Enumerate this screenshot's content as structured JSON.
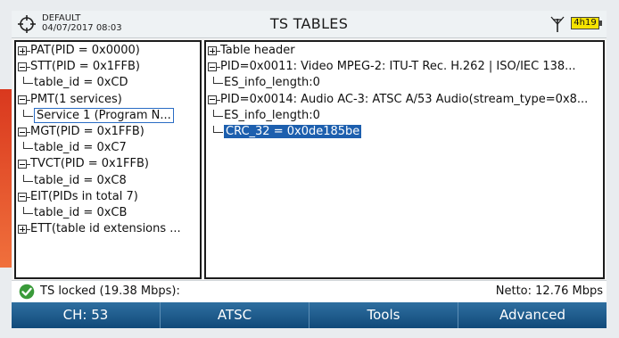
{
  "header": {
    "profile_name": "DEFAULT",
    "datetime": "04/07/2017 08:03",
    "title": "TS TABLES",
    "battery_label": "4h19"
  },
  "left_tree": [
    {
      "label": "PAT(PID = 0x0000)",
      "toggle": "plus"
    },
    {
      "label": "STT(PID = 0x1FFB)",
      "toggle": "minus"
    },
    {
      "label": "table_id = 0xCD",
      "toggle": "leaf"
    },
    {
      "label": "PMT(1 services)",
      "toggle": "minus"
    },
    {
      "label": "Service 1 (Program N...",
      "toggle": "leaf",
      "selected": true
    },
    {
      "label": "MGT(PID = 0x1FFB)",
      "toggle": "minus"
    },
    {
      "label": "table_id = 0xC7",
      "toggle": "leaf"
    },
    {
      "label": "TVCT(PID = 0x1FFB)",
      "toggle": "minus"
    },
    {
      "label": "table_id = 0xC8",
      "toggle": "leaf"
    },
    {
      "label": "EIT(PIDs in total 7)",
      "toggle": "minus"
    },
    {
      "label": "table_id = 0xCB",
      "toggle": "leaf"
    },
    {
      "label": "ETT(table id extensions ...",
      "toggle": "plus"
    }
  ],
  "right_tree": [
    {
      "label": "Table header",
      "toggle": "plus"
    },
    {
      "label": "PID=0x0011: Video MPEG-2: ITU-T Rec. H.262 | ISO/IEC 138...",
      "toggle": "minus"
    },
    {
      "label": "ES_info_length:0",
      "toggle": "leaf"
    },
    {
      "label": "PID=0x0014: Audio AC-3: ATSC A/53 Audio(stream_type=0x8...",
      "toggle": "minus"
    },
    {
      "label": "ES_info_length:0",
      "toggle": "leaf"
    },
    {
      "label": "CRC_32 = 0x0de185be",
      "toggle": "leaf",
      "selected": true
    }
  ],
  "status": {
    "text": "TS locked (19.38 Mbps):",
    "netto": "Netto: 12.76 Mbps"
  },
  "softkeys": [
    "CH: 53",
    "ATSC",
    "Tools",
    "Advanced"
  ],
  "colors": {
    "selection": "#1d5fae",
    "softkey_bar": "#1a5a8c",
    "battery": "#f5e300",
    "accent": "#e2492a"
  }
}
